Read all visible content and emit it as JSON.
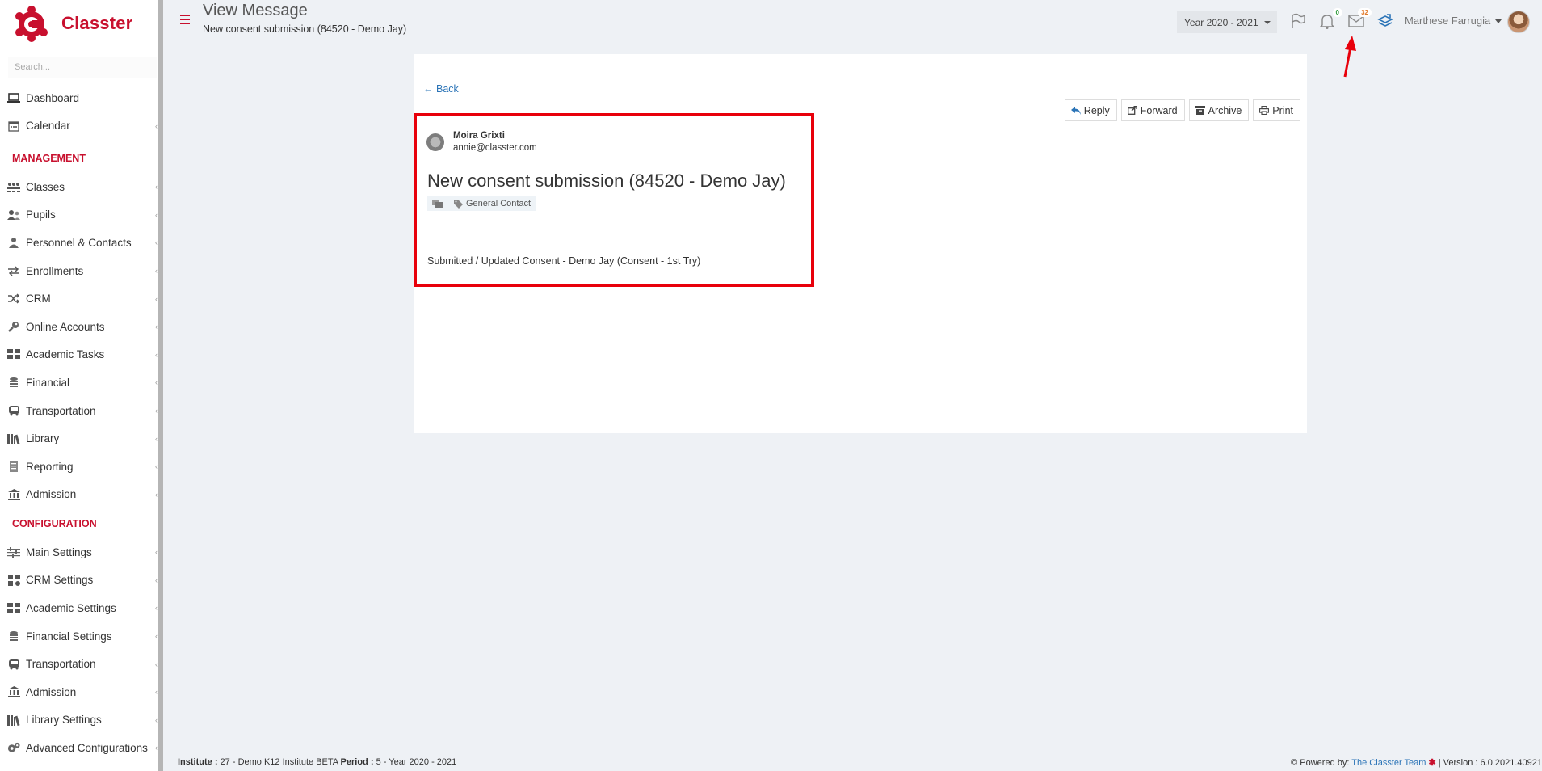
{
  "app": {
    "name": "Classter",
    "brand_color": "#c8102e"
  },
  "sidebar": {
    "search_placeholder": "Search...",
    "items_top": [
      {
        "label": "Dashboard",
        "icon": "laptop-icon"
      },
      {
        "label": "Calendar",
        "icon": "calendar-icon"
      }
    ],
    "management_heading": "MANAGEMENT",
    "management_items": [
      {
        "label": "Classes",
        "icon": "classes-icon"
      },
      {
        "label": "Pupils",
        "icon": "pupils-icon"
      },
      {
        "label": "Personnel & Contacts",
        "icon": "personnel-icon"
      },
      {
        "label": "Enrollments",
        "icon": "exchange-icon"
      },
      {
        "label": "CRM",
        "icon": "shuffle-icon"
      },
      {
        "label": "Online Accounts",
        "icon": "key-icon"
      },
      {
        "label": "Academic Tasks",
        "icon": "grid-icon"
      },
      {
        "label": "Financial",
        "icon": "coins-icon"
      },
      {
        "label": "Transportation",
        "icon": "bus-icon"
      },
      {
        "label": "Library",
        "icon": "books-icon"
      },
      {
        "label": "Reporting",
        "icon": "report-icon"
      },
      {
        "label": "Admission",
        "icon": "institution-icon"
      }
    ],
    "configuration_heading": "CONFIGURATION",
    "configuration_items": [
      {
        "label": "Main Settings",
        "icon": "sliders-icon"
      },
      {
        "label": "CRM Settings",
        "icon": "crm-settings-icon"
      },
      {
        "label": "Academic Settings",
        "icon": "grid-icon"
      },
      {
        "label": "Financial Settings",
        "icon": "coins-icon"
      },
      {
        "label": "Transportation",
        "icon": "bus-icon"
      },
      {
        "label": "Admission",
        "icon": "institution-icon"
      },
      {
        "label": "Library Settings",
        "icon": "books-icon"
      },
      {
        "label": "Advanced Configurations",
        "icon": "gears-icon"
      }
    ]
  },
  "header": {
    "title": "View Message",
    "subtitle": "New consent submission (84520 - Demo Jay)",
    "year_selector": "Year 2020 - 2021",
    "notifications_count": "0",
    "messages_count": "32",
    "user_name": "Marthese Farrugia"
  },
  "message": {
    "back_label": "Back",
    "actions": {
      "reply": "Reply",
      "forward": "Forward",
      "archive": "Archive",
      "print": "Print"
    },
    "sender_name": "Moira Grixti",
    "sender_email": "annie@classter.com",
    "subject": "New consent submission (84520 - Demo Jay)",
    "tag": "General Contact",
    "body": "Submitted / Updated Consent - Demo Jay (Consent - 1st Try)",
    "highlight_color": "#e8000b"
  },
  "footer": {
    "institute_label": "Institute :",
    "institute_value": "27 - Demo K12 Institute BETA",
    "period_label": "Period :",
    "period_value": "5 - Year 2020 - 2021",
    "powered_by": "Powered by:",
    "team_link": "The Classter Team",
    "version": "| Version : 6.0.2021.40921"
  }
}
